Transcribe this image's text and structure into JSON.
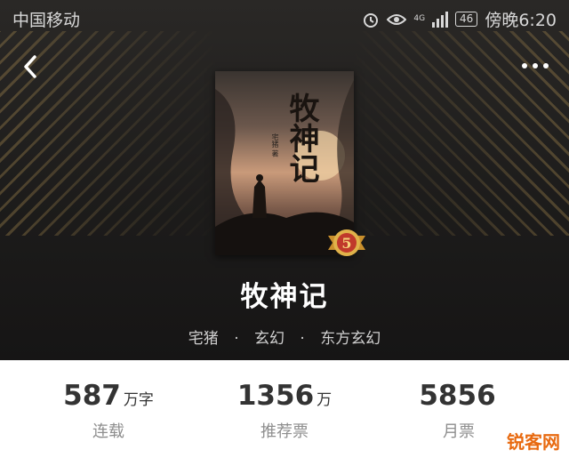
{
  "status_bar": {
    "carrier": "中国移动",
    "net_type": "4G",
    "battery": "46",
    "time": "傍晚6:20"
  },
  "nav": {
    "back_icon": "chevron-left-icon",
    "more_icon": "more-dots-icon"
  },
  "book": {
    "cover_title": "牧神记",
    "cover_author": "宅猪 著",
    "badge_number": "5",
    "title": "牧神记",
    "author": "宅猪",
    "category": "玄幻",
    "subcategory": "东方玄幻",
    "separator": "·"
  },
  "stats": [
    {
      "value": "587",
      "unit": "万字",
      "label": "连载"
    },
    {
      "value": "1356",
      "unit": "万",
      "label": "推荐票"
    },
    {
      "value": "5856",
      "unit": "",
      "label": "月票"
    }
  ],
  "watermark": "锐客网",
  "colors": {
    "header_bg": "#1d1c1b",
    "stripe_gold": "#c4a05a",
    "badge_gold": "#e0b24a",
    "badge_red": "#c0392b"
  }
}
